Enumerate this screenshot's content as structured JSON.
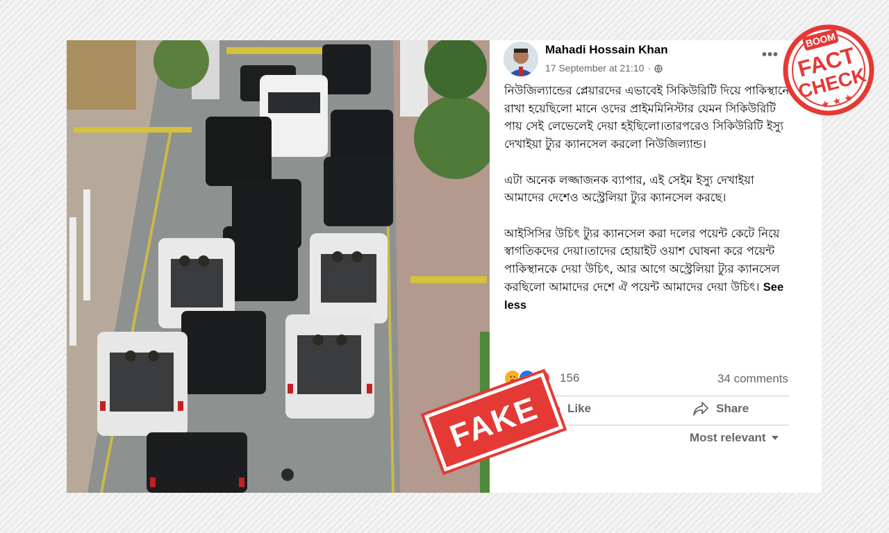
{
  "post": {
    "author": "Mahadi Hossain Khan",
    "timestamp": "17 September at 21:10",
    "visibility_icon": "globe-icon",
    "more_icon": "•••",
    "paragraphs": [
      "নিউজিল্যান্ডের প্লেয়ারদের এভাবেই সিকিউরিটি দিয়ে পাকিস্থানে রাখা হয়েছিলো মানে ওদের প্রাইমমিনিস্টার যেমন সিকিউরিটি পায় সেই লেভেলেই দেয়া হইছিলো।তারপরেও সিকিউরিটি ইস্যু দেখাইয়া ট্যুর ক্যানসেল করলো নিউজিল্যান্ড।",
      "এটা অনেক লজ্জাজনক ব্যাপার, এই সেইম ইস্যু দেখাইয়া আমাদের দেশেও অস্ট্রেলিয়া ট্যুর ক্যানসেল করছে।",
      "আইসিসির উচিৎ ট্যুর ক্যানসেল করা দলের পয়েন্ট কেটে নিয়ে স্বাগতিকদের দেয়া।তাদের হোয়াইট ওয়াশ ঘোষনা করে পয়েন্ট পাকিস্থানকে দেয়া উচিৎ, আর আগে অস্ট্রেলিয়া ট্যুর ক্যানসেল করছিলো আমাদের দেশে ঐ পয়েন্ট আমাদের দেয়া উচিৎ।"
    ],
    "see_less": "See less",
    "reactions_count": "156",
    "comments_count": "34 comments",
    "like_label": "Like",
    "share_label": "Share",
    "sort_label": "Most relevant"
  },
  "overlays": {
    "fake_stamp": "FAKE",
    "fact_check_brand": "BOOM",
    "fact_check_line1": "FACT",
    "fact_check_line2": "CHECK"
  },
  "colors": {
    "stamp_red": "#e53935",
    "meta_grey": "#65676b",
    "like_blue": "#1877f2",
    "love_red": "#f33e58",
    "sad_yellow": "#f7b125"
  }
}
